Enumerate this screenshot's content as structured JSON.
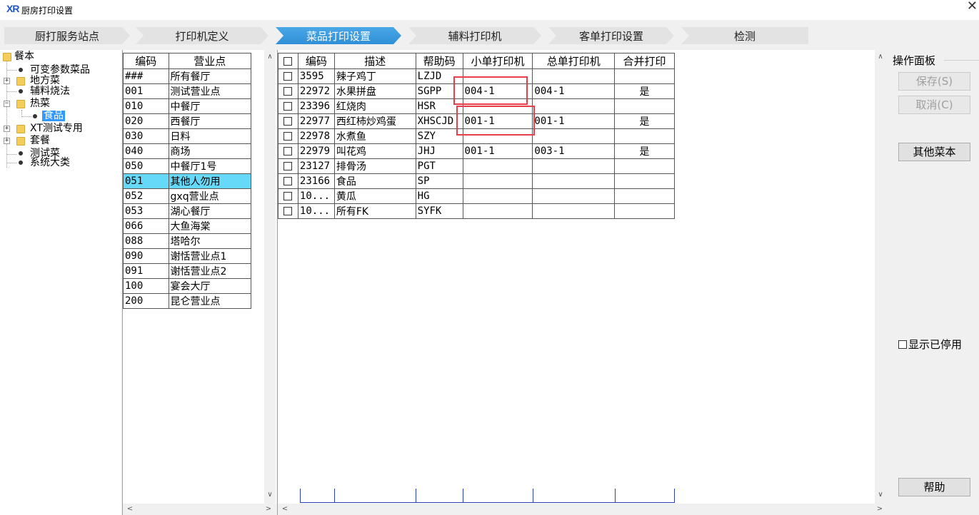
{
  "window": {
    "logo": "XR",
    "title": "厨房打印设置",
    "close": "✕"
  },
  "tabs": [
    {
      "label": "厨打服务站点",
      "active": false
    },
    {
      "label": "打印机定义",
      "active": false
    },
    {
      "label": "菜品打印设置",
      "active": true
    },
    {
      "label": "辅料打印机",
      "active": false
    },
    {
      "label": "客单打印设置",
      "active": false
    },
    {
      "label": "检测",
      "active": false
    }
  ],
  "tree": {
    "root": "餐本",
    "items": [
      {
        "label": "可变参数菜品"
      },
      {
        "label": "地方菜"
      },
      {
        "label": "辅料烧法"
      },
      {
        "label": "热菜"
      },
      {
        "label": "食品"
      },
      {
        "label": "XT测试专用"
      },
      {
        "label": "套餐"
      },
      {
        "label": "测试菜"
      },
      {
        "label": "系统大类"
      }
    ]
  },
  "sites": {
    "headers": [
      "编码",
      "营业点"
    ],
    "rows": [
      [
        "###",
        "所有餐厅"
      ],
      [
        "001",
        "测试营业点"
      ],
      [
        "010",
        "中餐厅"
      ],
      [
        "020",
        "西餐厅"
      ],
      [
        "030",
        "日料"
      ],
      [
        "040",
        "商场"
      ],
      [
        "050",
        "中餐厅1号"
      ],
      [
        "051",
        "其他人勿用"
      ],
      [
        "052",
        "gxq营业点"
      ],
      [
        "053",
        "湖心餐厅"
      ],
      [
        "066",
        "大鱼海棠"
      ],
      [
        "088",
        "塔哈尔"
      ],
      [
        "090",
        "谢恬营业点1"
      ],
      [
        "091",
        "谢恬营业点2"
      ],
      [
        "100",
        "宴会大厅"
      ],
      [
        "200",
        "昆仑营业点"
      ]
    ],
    "selected_index": 7
  },
  "dishes": {
    "headers": [
      "编码",
      "描述",
      "帮助码",
      "小单打印机",
      "总单打印机",
      "合并打印"
    ],
    "rows": [
      [
        "3595",
        "辣子鸡丁",
        "LZJD",
        "",
        "",
        ""
      ],
      [
        "22972",
        "水果拼盘",
        "SGPP",
        "004-1",
        "004-1",
        "是"
      ],
      [
        "23396",
        "红烧肉",
        "HSR",
        "",
        "",
        ""
      ],
      [
        "22977",
        "西红柿炒鸡蛋",
        "XHSCJD",
        "001-1",
        "001-1",
        "是"
      ],
      [
        "22978",
        "水煮鱼",
        "SZY",
        "",
        "",
        ""
      ],
      [
        "22979",
        "叫花鸡",
        "JHJ",
        "001-1",
        "003-1",
        "是"
      ],
      [
        "23127",
        "排骨汤",
        "PGT",
        "",
        "",
        ""
      ],
      [
        "23166",
        "食品",
        "SP",
        "",
        "",
        ""
      ],
      [
        "10...",
        "黄瓜",
        "HG",
        "",
        "",
        ""
      ],
      [
        "10...",
        "所有FK",
        "SYFK",
        "",
        "",
        ""
      ]
    ]
  },
  "ops": {
    "title": "操作面板",
    "save": "保存(S)",
    "cancel": "取消(C)",
    "other_dishes": "其他菜本",
    "show_disabled": "显示已停用",
    "help": "帮助"
  },
  "scroll": {
    "up": "∧",
    "down": "∨",
    "left": "<",
    "right": ">"
  },
  "colors": {
    "active_tab": "#2f8fd6",
    "selected_row": "#66d9f8",
    "tree_selected": "#3399ff",
    "highlight_box": "#e8404a"
  }
}
